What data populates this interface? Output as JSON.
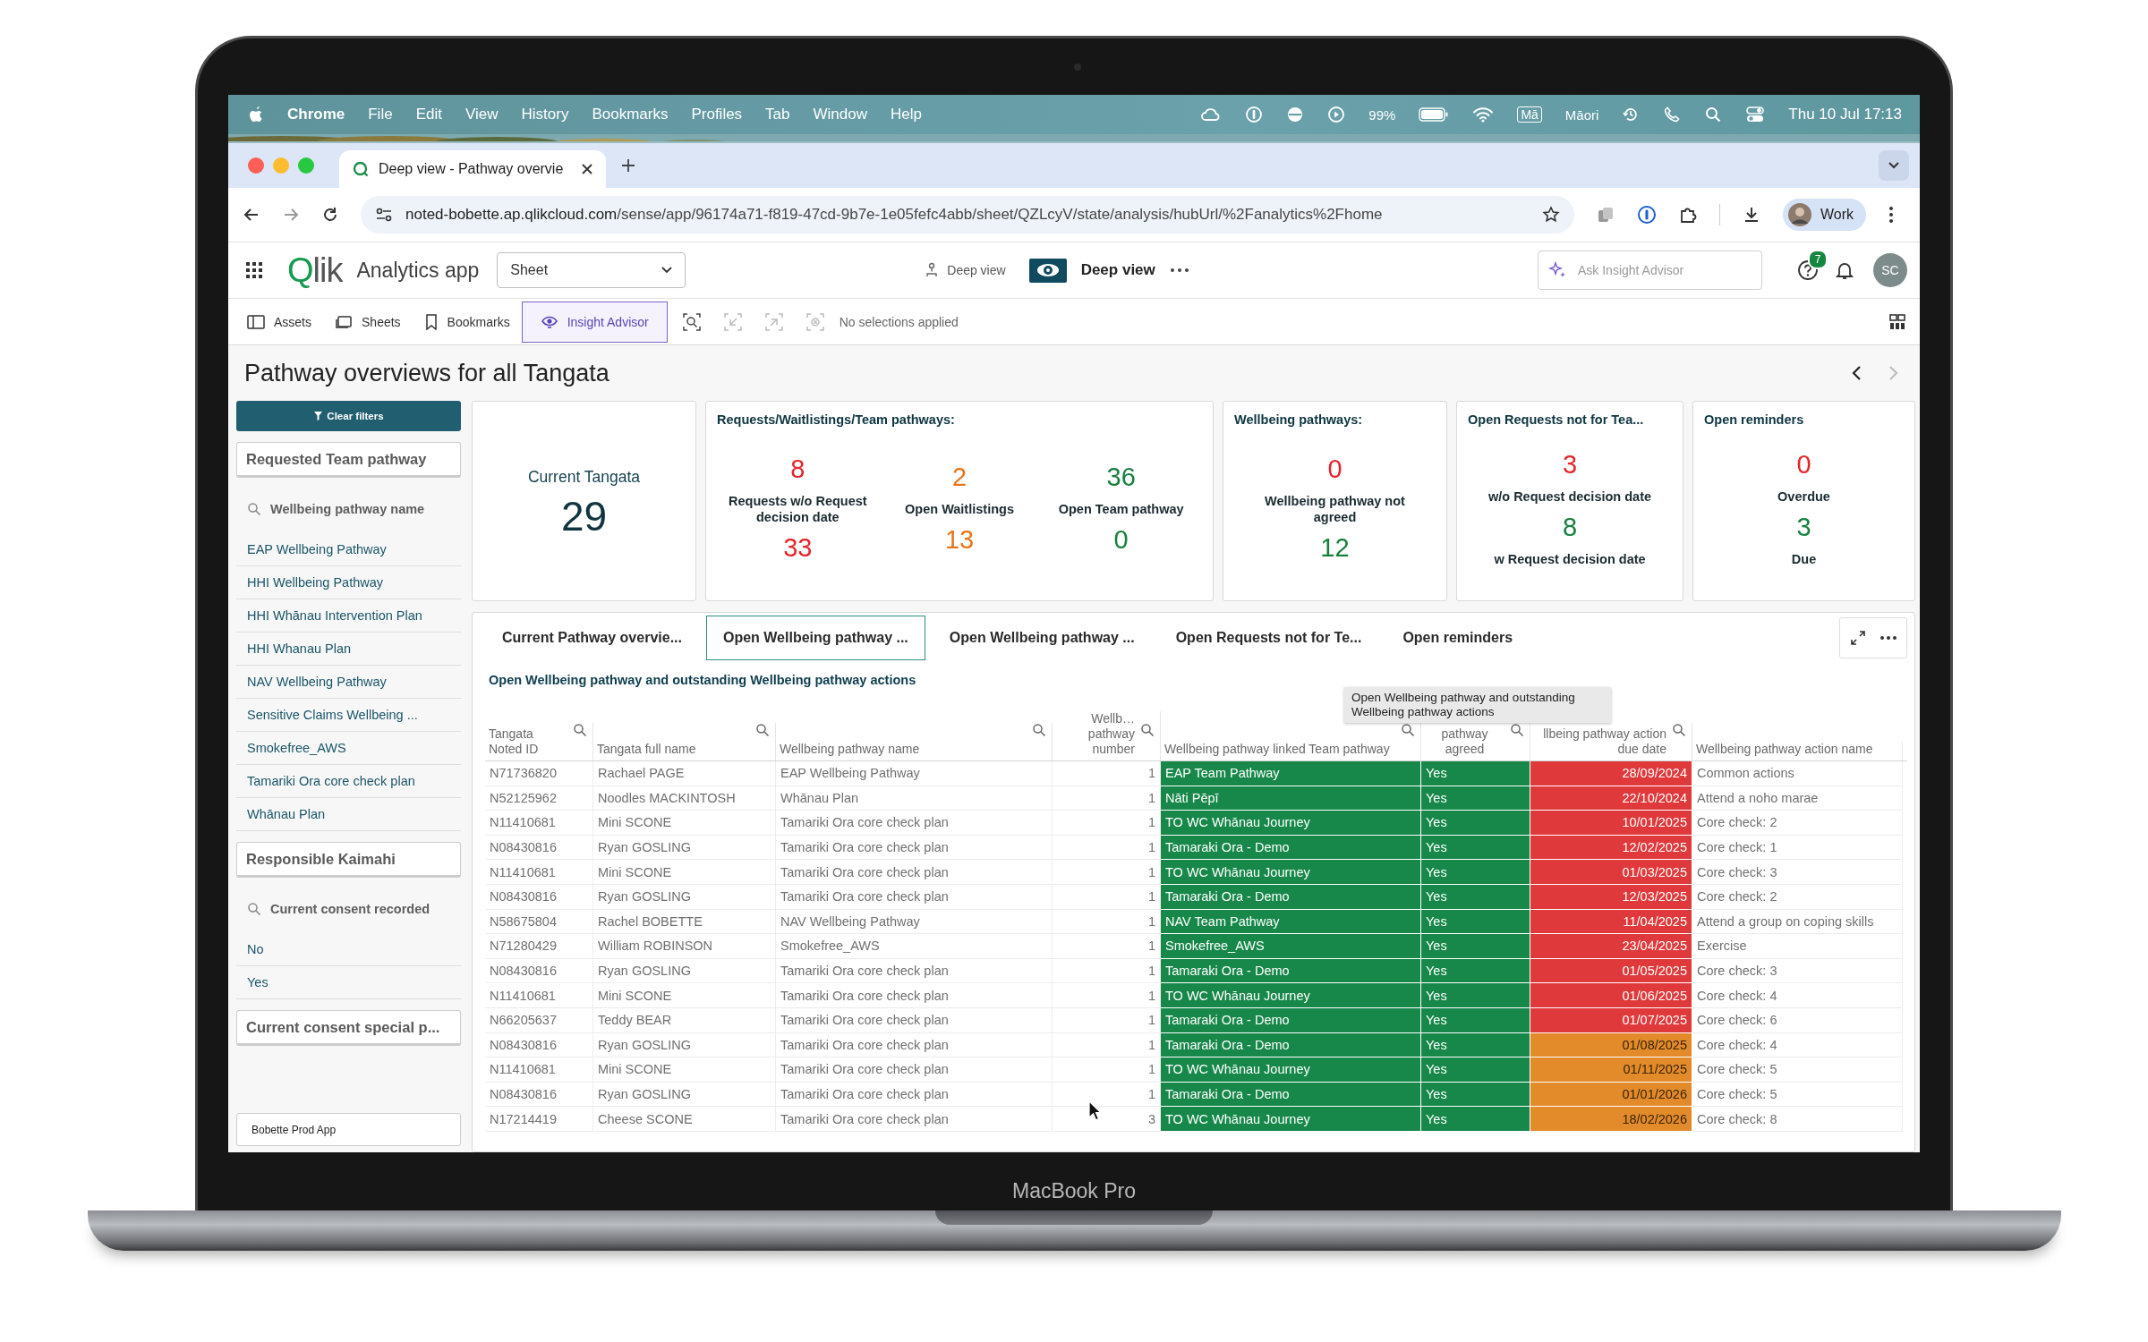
{
  "device": {
    "label": "MacBook Pro"
  },
  "menu_bar": {
    "app": "Chrome",
    "menus": [
      "File",
      "Edit",
      "View",
      "History",
      "Bookmarks",
      "Profiles",
      "Tab",
      "Window",
      "Help"
    ],
    "battery": "99%",
    "input_source": "Mā",
    "language": "Māori",
    "clock": "Thu 10 Jul  17:13"
  },
  "browser": {
    "tab_title": "Deep view - Pathway overvie",
    "url_host": "noted-bobette.ap.qlikcloud.com",
    "url_path": "/sense/app/96174a71-f819-47cd-9b7e-1e05fefc4abb/sheet/QZLcyV/state/analysis/hubUrl/%2Fanalytics%2Fhome",
    "profile": "Work"
  },
  "app_header": {
    "logo": "Qlik",
    "app_name": "Analytics app",
    "sheet_select": "Sheet",
    "breadcrumb": "Deep view",
    "sheet_name": "Deep view",
    "search_placeholder": "Ask Insight Advisor",
    "help_badge": "7",
    "avatar": "SC"
  },
  "toolbar": {
    "items": [
      {
        "kind": "assets",
        "label": "Assets",
        "selected": false
      },
      {
        "kind": "sheets",
        "label": "Sheets",
        "selected": false
      },
      {
        "kind": "bookmarks",
        "label": "Bookmarks",
        "selected": false
      },
      {
        "kind": "insight",
        "label": "Insight Advisor",
        "selected": true
      }
    ],
    "selections": "No selections applied"
  },
  "sheet_title": "Pathway overviews for all Tangata",
  "filter_pane": {
    "clear_button": "Clear filters",
    "items": [
      {
        "kind": "listbox",
        "label": "Requested Team pathway"
      },
      {
        "kind": "search",
        "label": "Wellbeing pathway name"
      },
      {
        "kind": "value",
        "label": "EAP Wellbeing Pathway"
      },
      {
        "kind": "value",
        "label": "HHI Wellbeing Pathway"
      },
      {
        "kind": "value",
        "label": "HHI Whānau Intervention Plan"
      },
      {
        "kind": "value",
        "label": "HHI Whanau Plan"
      },
      {
        "kind": "value",
        "label": "NAV Wellbeing Pathway"
      },
      {
        "kind": "value",
        "label": "Sensitive Claims Wellbeing ..."
      },
      {
        "kind": "value",
        "label": "Smokefree_AWS"
      },
      {
        "kind": "value",
        "label": "Tamariki Ora core check plan"
      },
      {
        "kind": "value",
        "label": "Whānau Plan"
      },
      {
        "kind": "listbox",
        "label": "Responsible Kaimahi"
      },
      {
        "kind": "search",
        "label": "Current consent recorded"
      },
      {
        "kind": "value",
        "label": "No"
      },
      {
        "kind": "value",
        "label": "Yes"
      },
      {
        "kind": "listbox",
        "label": "Current consent special p..."
      }
    ],
    "app_button": "Bobette Prod App"
  },
  "kpi_cards": [
    {
      "columns": [
        [
          {
            "kind": "caption",
            "text": "Current Tangata"
          },
          {
            "kind": "big",
            "text": "29",
            "color": "#11343f"
          }
        ]
      ]
    },
    {
      "title": "Requests/Waitlistings/Team pathways:",
      "columns": [
        [
          {
            "kind": "value",
            "text": "8",
            "color": "#e3262b"
          },
          {
            "kind": "label",
            "text": "Requests w/o Request decision date"
          },
          {
            "kind": "value",
            "text": "33",
            "color": "#e3262b"
          }
        ],
        [
          {
            "kind": "value",
            "text": "2",
            "color": "#e8761c"
          },
          {
            "kind": "label",
            "text": "Open Waitlistings"
          },
          {
            "kind": "value",
            "text": "13",
            "color": "#e8761c"
          }
        ],
        [
          {
            "kind": "value",
            "text": "36",
            "color": "#18803f"
          },
          {
            "kind": "label",
            "text": "Open Team pathway"
          },
          {
            "kind": "value",
            "text": "0",
            "color": "#18803f"
          }
        ]
      ]
    },
    {
      "title": "Wellbeing pathways:",
      "columns": [
        [
          {
            "kind": "value",
            "text": "0",
            "color": "#e3262b"
          },
          {
            "kind": "label",
            "text": "Wellbeing pathway not agreed"
          },
          {
            "kind": "value",
            "text": "12",
            "color": "#18803f"
          }
        ]
      ]
    },
    {
      "title": "Open Requests not for Tea...",
      "columns": [
        [
          {
            "kind": "value",
            "text": "3",
            "color": "#e3262b"
          },
          {
            "kind": "label",
            "text": "w/o Request decision date"
          },
          {
            "kind": "value",
            "text": "8",
            "color": "#18803f"
          },
          {
            "kind": "label",
            "text": "w Request decision date"
          }
        ]
      ]
    },
    {
      "title": "Open reminders",
      "columns": [
        [
          {
            "kind": "value",
            "text": "0",
            "color": "#e3262b"
          },
          {
            "kind": "label",
            "text": "Overdue"
          },
          {
            "kind": "value",
            "text": "3",
            "color": "#18803f"
          },
          {
            "kind": "label",
            "text": "Due"
          }
        ]
      ]
    }
  ],
  "panel": {
    "tabs": [
      {
        "label": "Current Pathway overvie...",
        "selected": false
      },
      {
        "label": "Open Wellbeing pathway ...",
        "selected": true
      },
      {
        "label": "Open Wellbeing pathway ...",
        "selected": false
      },
      {
        "label": "Open Requests not for Te...",
        "selected": false
      },
      {
        "label": "Open reminders",
        "selected": false
      }
    ],
    "subtitle": "Open Wellbeing pathway and outstanding Wellbeing pathway actions",
    "tooltip": "Open Wellbeing pathway and outstanding Wellbeing pathway actions",
    "table": {
      "columns": [
        {
          "label": "Tangata Noted ID",
          "search": true
        },
        {
          "label": "Tangata full name",
          "search": true
        },
        {
          "label": "Wellbeing pathway name",
          "search": true
        },
        {
          "label": "Wellb… pathway number",
          "search": true
        },
        {
          "label": "Wellbeing pathway linked Team pathway",
          "search": true
        },
        {
          "label": "pathway agreed",
          "search": true
        },
        {
          "label": "llbeing pathway action due date",
          "search": true
        },
        {
          "label": "Wellbeing pathway action name",
          "search": false
        }
      ],
      "rows": [
        {
          "cells": [
            "N71736820",
            "Rachael PAGE",
            "EAP Wellbeing Pathway",
            "1",
            "EAP Team Pathway",
            "Yes",
            "28/09/2024",
            "Common actions"
          ],
          "color": "#e0393b"
        },
        {
          "cells": [
            "N52125962",
            "Noodles MACKINTOSH",
            "Whānau Plan",
            "1",
            "Nāti Pēpī",
            "Yes",
            "22/10/2024",
            "Attend a noho marae"
          ],
          "color": "#e0393b"
        },
        {
          "cells": [
            "N11410681",
            "Mini SCONE",
            "Tamariki Ora core check plan",
            "1",
            "TO WC Whānau Journey",
            "Yes",
            "10/01/2025",
            "Core check: 2"
          ],
          "color": "#e0393b"
        },
        {
          "cells": [
            "N08430816",
            "Ryan GOSLING",
            "Tamariki Ora core check plan",
            "1",
            "Tamaraki Ora - Demo",
            "Yes",
            "12/02/2025",
            "Core check: 1"
          ],
          "color": "#e0393b"
        },
        {
          "cells": [
            "N11410681",
            "Mini SCONE",
            "Tamariki Ora core check plan",
            "1",
            "TO WC Whānau Journey",
            "Yes",
            "01/03/2025",
            "Core check: 3"
          ],
          "color": "#e0393b"
        },
        {
          "cells": [
            "N08430816",
            "Ryan GOSLING",
            "Tamariki Ora core check plan",
            "1",
            "Tamaraki Ora - Demo",
            "Yes",
            "12/03/2025",
            "Core check: 2"
          ],
          "color": "#e0393b"
        },
        {
          "cells": [
            "N58675804",
            "Rachel BOBETTE",
            "NAV Wellbeing Pathway",
            "1",
            "NAV Team Pathway",
            "Yes",
            "11/04/2025",
            "Attend a group on coping skills"
          ],
          "color": "#e0393b"
        },
        {
          "cells": [
            "N71280429",
            "William ROBINSON",
            "Smokefree_AWS",
            "1",
            "Smokefree_AWS",
            "Yes",
            "23/04/2025",
            "Exercise"
          ],
          "color": "#e0393b"
        },
        {
          "cells": [
            "N08430816",
            "Ryan GOSLING",
            "Tamariki Ora core check plan",
            "1",
            "Tamaraki Ora - Demo",
            "Yes",
            "01/05/2025",
            "Core check: 3"
          ],
          "color": "#e0393b"
        },
        {
          "cells": [
            "N11410681",
            "Mini SCONE",
            "Tamariki Ora core check plan",
            "1",
            "TO WC Whānau Journey",
            "Yes",
            "01/06/2025",
            "Core check: 4"
          ],
          "color": "#e0393b"
        },
        {
          "cells": [
            "N66205637",
            "Teddy BEAR",
            "Tamariki Ora core check plan",
            "1",
            "Tamaraki Ora - Demo",
            "Yes",
            "01/07/2025",
            "Core check: 6"
          ],
          "color": "#e0393b"
        },
        {
          "cells": [
            "N08430816",
            "Ryan GOSLING",
            "Tamariki Ora core check plan",
            "1",
            "Tamaraki Ora - Demo",
            "Yes",
            "01/08/2025",
            "Core check: 4"
          ],
          "color": "#e38a2a"
        },
        {
          "cells": [
            "N11410681",
            "Mini SCONE",
            "Tamariki Ora core check plan",
            "1",
            "TO WC Whānau Journey",
            "Yes",
            "01/11/2025",
            "Core check: 5"
          ],
          "color": "#e38a2a"
        },
        {
          "cells": [
            "N08430816",
            "Ryan GOSLING",
            "Tamariki Ora core check plan",
            "1",
            "Tamaraki Ora - Demo",
            "Yes",
            "01/01/2026",
            "Core check: 5"
          ],
          "color": "#e38a2a"
        },
        {
          "cells": [
            "N17214419",
            "Cheese SCONE",
            "Tamariki Ora core check plan",
            "3",
            "TO WC Whānau Journey",
            "Yes",
            "18/02/2026",
            "Core check: 8"
          ],
          "color": "#e38a2a"
        }
      ]
    }
  }
}
